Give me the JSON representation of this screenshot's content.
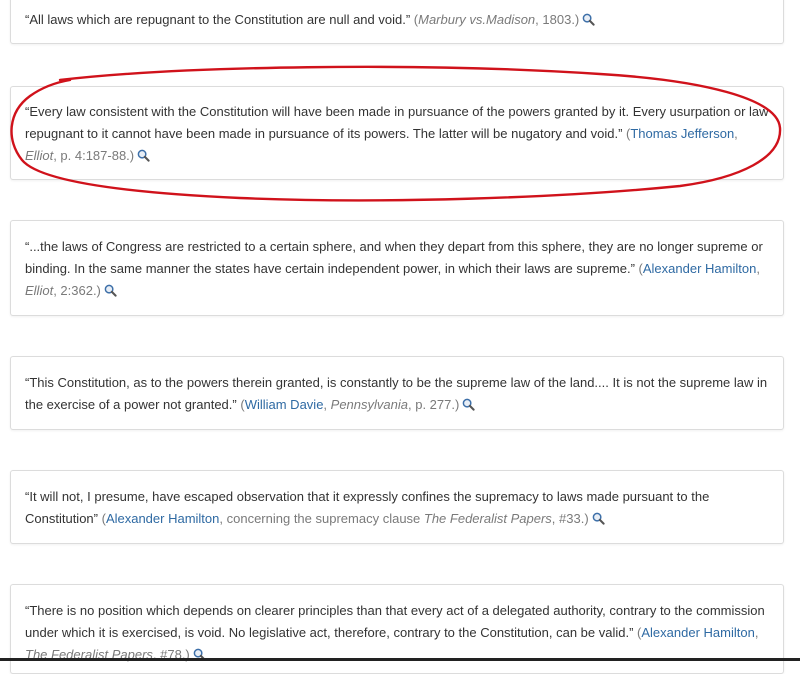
{
  "quotes": [
    {
      "text": "“All laws which are repugnant to the Constitution are null and void.”",
      "open": " (",
      "source": "Marbury vs.Madison",
      "after": ", 1803.)",
      "icon": "magnifier-icon"
    },
    {
      "text": "“Every law consistent with the Constitution will have been made in pursuance of the powers granted by it. Every usurpation or law repugnant to it cannot have been made in pursuance of its powers. The latter will be nugatory and void.”",
      "open": " (",
      "author": "Thomas Jefferson",
      "sep": ", ",
      "source": "Elliot",
      "after": ", p. 4:187-88.)",
      "icon": "magnifier-icon"
    },
    {
      "text": "“...the laws of Congress are restricted to a certain sphere, and when they depart from this sphere, they are no longer supreme or binding. In the same manner the states have certain independent power, in which their laws are supreme.”",
      "open": " (",
      "author": "Alexander Hamilton",
      "sep": ", ",
      "source": "Elliot",
      "after": ", 2:362.)",
      "icon": "magnifier-icon"
    },
    {
      "text": "“This Constitution, as to the powers therein granted, is constantly to be the supreme law of the land.... It is not the supreme law in the exercise of a power not granted.”",
      "open": " (",
      "author": "William Davie",
      "sep": ", ",
      "source": "Pennsylvania",
      "after": ", p. 277.)",
      "icon": "magnifier-icon"
    },
    {
      "text": "“It will not, I presume, have escaped observation that it expressly confines the supremacy to laws made pursuant to the Constitution”",
      "open": " (",
      "author": "Alexander Hamilton",
      "sep": ", concerning the supremacy clause ",
      "source": "The Federalist Papers",
      "after": ", #33.)",
      "icon": "magnifier-icon"
    },
    {
      "text": "“There is no position which depends on clearer principles than that every act of a delegated authority, contrary to the commission under which it is exercised, is void. No legislative act, therefore, contrary to the Constitution, can be valid.”",
      "open": " (",
      "author": "Alexander Hamilton",
      "sep": ", ",
      "source": "The Federalist Papers",
      "after": ", #78.)",
      "icon": "magnifier-icon"
    }
  ],
  "colors": {
    "link": "#2f6aa3",
    "cite": "#7a7a7a",
    "highlight": "#d0121b"
  }
}
